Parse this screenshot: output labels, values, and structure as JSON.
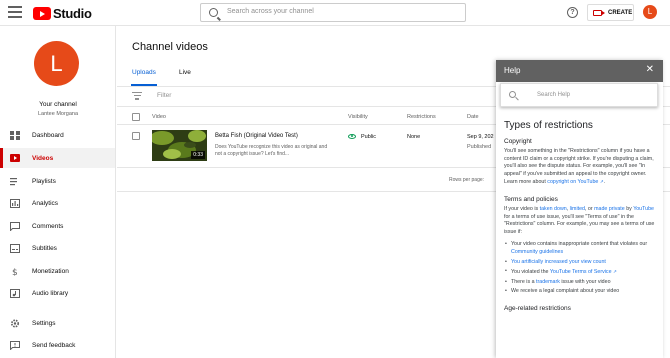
{
  "topbar": {
    "logo_text": "Studio",
    "search_placeholder": "Search across your channel",
    "help_glyph": "?",
    "create_label": "CREATE",
    "avatar_letter": "L"
  },
  "sidebar": {
    "avatar_letter": "L",
    "channel_label": "Your channel",
    "channel_name": "Lantee Morgana",
    "items": [
      {
        "label": "Dashboard",
        "icon": "dashboard-icon"
      },
      {
        "label": "Videos",
        "icon": "videos-icon"
      },
      {
        "label": "Playlists",
        "icon": "playlists-icon"
      },
      {
        "label": "Analytics",
        "icon": "analytics-icon"
      },
      {
        "label": "Comments",
        "icon": "comments-icon"
      },
      {
        "label": "Subtitles",
        "icon": "subtitles-icon"
      },
      {
        "label": "Monetization",
        "icon": "monetization-icon"
      },
      {
        "label": "Audio library",
        "icon": "audio-library-icon"
      },
      {
        "label": "Settings",
        "icon": "settings-icon"
      },
      {
        "label": "Send feedback",
        "icon": "feedback-icon"
      }
    ],
    "active_item": "Videos"
  },
  "main": {
    "title": "Channel videos",
    "tabs": [
      {
        "label": "Uploads"
      },
      {
        "label": "Live"
      }
    ],
    "filter_placeholder": "Filter",
    "columns": {
      "video": "Video",
      "visibility": "Visibility",
      "restrictions": "Restrictions",
      "date": "Date"
    },
    "rows": [
      {
        "title": "Betta Fish (Original Video Test)",
        "description": "Does YouTube recognize this video as original and not a copyright issue? Let's find...",
        "duration": "0:33",
        "visibility": "Public",
        "restrictions": "None",
        "date": "Sep 9, 202",
        "date_status": "Published"
      }
    ],
    "rows_per_page_label": "Rows per page:"
  },
  "help": {
    "header": "Help",
    "close_glyph": "✕",
    "search_placeholder": "Search Help",
    "title": "Types of restrictions",
    "sections": {
      "copyright": {
        "heading": "Copyright",
        "text": "You'll see something in the \"Restrictions\" column if you have a content ID claim or a copyright strike. If you're disputing a claim, you'll also see the dispute status. For example, you'll see \"In appeal\" if you've submitted an appeal to the copyright owner. Learn more about ",
        "link": "copyright on YouTube"
      },
      "terms": {
        "heading": "Terms and policies",
        "intro_1": "If your video is ",
        "link_taken_down": "taken down",
        "comma": ", ",
        "link_limited": "limited",
        "or": ", or ",
        "link_made_private": "made private",
        "by": " by ",
        "link_youtube": "YouTube",
        "intro_2": " for a terms of use issue, you'll see \"Terms of use\" in the \"Restrictions\" column. For example, you may see a terms of use issue if:",
        "bullets": {
          "b1_text": "Your video contains inappropriate content that violates our ",
          "b1_link": "Community guidelines",
          "b2_link": "You artificially increased your view count",
          "b3_text": "You violated the ",
          "b3_link": "YouTube Terms of Service",
          "b4_text_1": "There is a ",
          "b4_link": "trademark",
          "b4_text_2": " issue with your video",
          "b5_text": "We receive a legal complaint about your video"
        }
      },
      "age": {
        "heading": "Age-related restrictions"
      }
    }
  },
  "colors": {
    "brand_red": "#ff0000",
    "accent_blue": "#065fd4",
    "help_header": "#616161",
    "public_green": "#0f9d58"
  }
}
